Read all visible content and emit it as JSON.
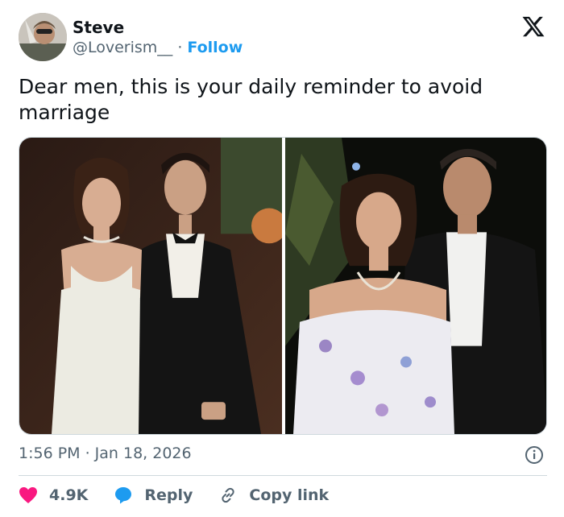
{
  "user": {
    "name": "Steve",
    "handle": "@Loverism__",
    "separator": "·",
    "follow_label": "Follow"
  },
  "tweet": {
    "text": "Dear men, this is your daily reminder to avoid marriage",
    "timestamp": "1:56 PM · Jan 18, 2026"
  },
  "actions": {
    "likes": "4.9K",
    "reply_label": "Reply",
    "copy_link_label": "Copy link"
  },
  "colors": {
    "like": "#f91880",
    "reply": "#1d9bf0",
    "follow": "#1d9bf0",
    "muted": "#536471"
  },
  "icons": {
    "logo": "x-logo-icon",
    "info": "info-icon",
    "like": "heart-icon",
    "reply": "speech-bubble-icon",
    "copy_link": "link-icon"
  }
}
